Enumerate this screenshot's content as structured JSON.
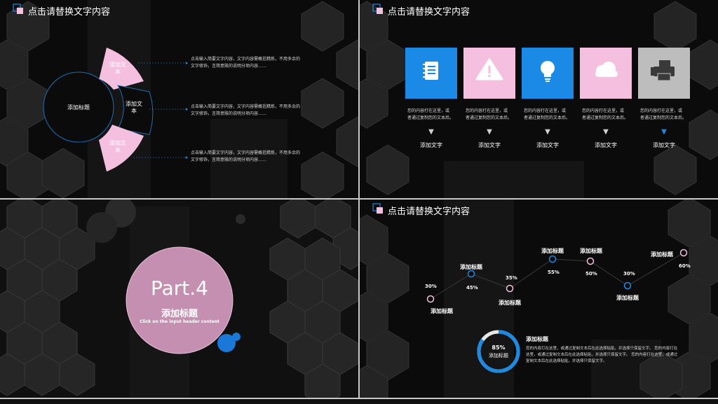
{
  "colors": {
    "pink": "#f5bfdf",
    "blue": "#1a8ae6",
    "gray": "#bdbdbd",
    "mauve": "#c48fb0"
  },
  "slide1": {
    "title": "点击请替换文字内容",
    "center": "添加标题",
    "segments": [
      "添加文本",
      "添加文本",
      "添加文本"
    ],
    "paragraphs": [
      [
        "点击输入简要文字内容，文字内容需概括精炼，不用多余的",
        "文字修饰，言简意赅的说明分项内容……"
      ],
      [
        "点击输入简要文字内容，文字内容需概括精炼，不用多余的",
        "文字修饰，言简意赅的说明分项内容……"
      ],
      [
        "点击输入简要文字内容，文字内容需概括精炼，不用多余的",
        "文字修饰，言简意赅的说明分项内容……"
      ]
    ]
  },
  "slide2": {
    "title": "点击请替换文字内容",
    "tiles": [
      {
        "icon": "notebook-icon",
        "color": "#1a8ae6",
        "desc": [
          "您的内容打在这里，或",
          "者通过复制您的文本后。"
        ],
        "label": "添加文字",
        "arrow": "▼",
        "arrow_color": "#cfcfcf"
      },
      {
        "icon": "warning-icon",
        "color": "#f5bfdf",
        "desc": [
          "您的内容打在这里，或",
          "者通过复制您的文本后。"
        ],
        "label": "添加文字",
        "arrow": "▼",
        "arrow_color": "#cfcfcf"
      },
      {
        "icon": "lightbulb-icon",
        "color": "#1a8ae6",
        "desc": [
          "您的内容打在这里，或",
          "者通过复制您的文本后。"
        ],
        "label": "添加文字",
        "arrow": "▼",
        "arrow_color": "#cfcfcf"
      },
      {
        "icon": "cloud-icon",
        "color": "#f5bfdf",
        "desc": [
          "您的内容打在这里，或",
          "者通过复制您的文本后。"
        ],
        "label": "添加文字",
        "arrow": "▼",
        "arrow_color": "#cfcfcf"
      },
      {
        "icon": "printer-icon",
        "color": "#bdbdbd",
        "desc": [
          "您的内容打在这里，或",
          "者通过复制您的文本后。"
        ],
        "label": "添加文字",
        "arrow": "▼",
        "arrow_color": "#1a8ae6"
      }
    ]
  },
  "slide3": {
    "part": "Part.4",
    "heading": "添加标题",
    "sub": "Click on the input header content"
  },
  "slide4": {
    "title": "点击请替换文字内容",
    "points": [
      {
        "label": "添加标题",
        "value": "30%",
        "color": "pink"
      },
      {
        "label": "添加标题",
        "value": "45%",
        "color": "blue"
      },
      {
        "label": "添加标题",
        "value": "35%",
        "color": "pink"
      },
      {
        "label": "添加标题",
        "value": "55%",
        "color": "blue"
      },
      {
        "label": "添加标题",
        "value": "50%",
        "color": "pink"
      },
      {
        "label": "添加标题",
        "value": "30%",
        "color": "blue"
      },
      {
        "label": "添加标题",
        "value": "60%",
        "color": "pink"
      }
    ],
    "ring": {
      "percent": "85%",
      "label": "添加标题",
      "fraction": 0.85
    },
    "note_title": "添加标题",
    "note_lines": [
      "您的内容打在这里，或通过复制文本后在此选择粘贴，并选择只保留文字。 您的内容打在",
      "这里，或通过复制文本后在此选择粘贴，并选择只保留文字。 您的内容打在这里，或通过",
      "复制文本后在此选择粘贴，并选择只保留文字。"
    ]
  }
}
